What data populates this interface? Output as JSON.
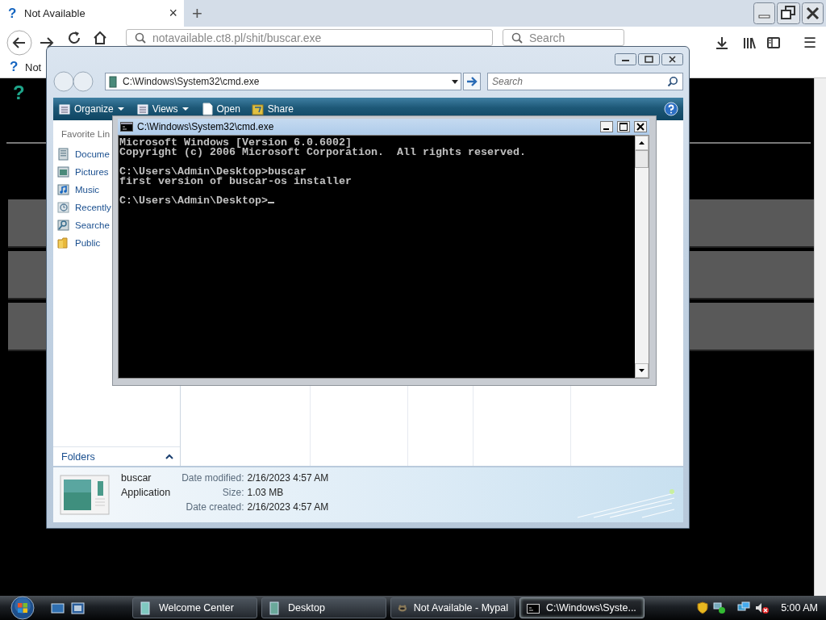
{
  "browser": {
    "tabs": [
      {
        "favicon": "?",
        "title": "Not Available",
        "close": "×",
        "selected": true
      }
    ],
    "new_tab": "+",
    "address": "notavailable.ct8.pl/shit/buscar.exe",
    "search_placeholder": "Search",
    "menu": "☰",
    "bookmarks": [
      {
        "favicon": "?",
        "label": "Not"
      }
    ],
    "content_icon": "?"
  },
  "explorer": {
    "address": "C:\\Windows\\System32\\cmd.exe",
    "search_placeholder": "Search",
    "toolbar": [
      {
        "label": "Organize",
        "kind": "menu"
      },
      {
        "label": "Views",
        "kind": "menu"
      },
      {
        "label": "Open",
        "kind": "action"
      },
      {
        "label": "Share",
        "kind": "share"
      }
    ],
    "favorites_heading": "Favorite Lin",
    "links": [
      {
        "label": "Docume",
        "kind": "documents"
      },
      {
        "label": "Pictures",
        "kind": "pictures"
      },
      {
        "label": "Music",
        "kind": "music"
      },
      {
        "label": "Recently",
        "kind": "recent"
      },
      {
        "label": "Searche",
        "kind": "searches"
      },
      {
        "label": "Public",
        "kind": "folder"
      }
    ],
    "folders_label": "Folders",
    "details": {
      "name": "buscar",
      "type": "Application",
      "fields": [
        {
          "label": "Date modified:",
          "value": "2/16/2023 4:57 AM"
        },
        {
          "label": "Size:",
          "value": "1.03 MB"
        },
        {
          "label": "Date created:",
          "value": "2/16/2023 4:57 AM"
        }
      ]
    }
  },
  "cmd": {
    "title": "C:\\Windows\\System32\\cmd.exe",
    "lines": [
      {
        "text": "Microsoft Windows [Version 6.0.6002]",
        "blank_before": false,
        "cursor": false
      },
      {
        "text": "Copyright (c) 2006 Microsoft Corporation.  All rights reserved.",
        "blank_before": false,
        "cursor": false
      },
      {
        "text": "C:\\Users\\Admin\\Desktop>buscar",
        "blank_before": true,
        "cursor": false
      },
      {
        "text": "first version of buscar-os installer",
        "blank_before": false,
        "cursor": false
      },
      {
        "text": "C:\\Users\\Admin\\Desktop>",
        "blank_before": true,
        "cursor": true
      }
    ]
  },
  "taskbar": {
    "buttons": [
      {
        "label": "Welcome Center",
        "kind": "welcome",
        "selected": false
      },
      {
        "label": "Desktop",
        "kind": "explorer",
        "selected": false
      },
      {
        "label": "Not Available - Mypal",
        "kind": "browser",
        "selected": false
      },
      {
        "label": "C:\\Windows\\Syste...",
        "kind": "console",
        "selected": true
      }
    ],
    "clock": "5:00 AM"
  }
}
